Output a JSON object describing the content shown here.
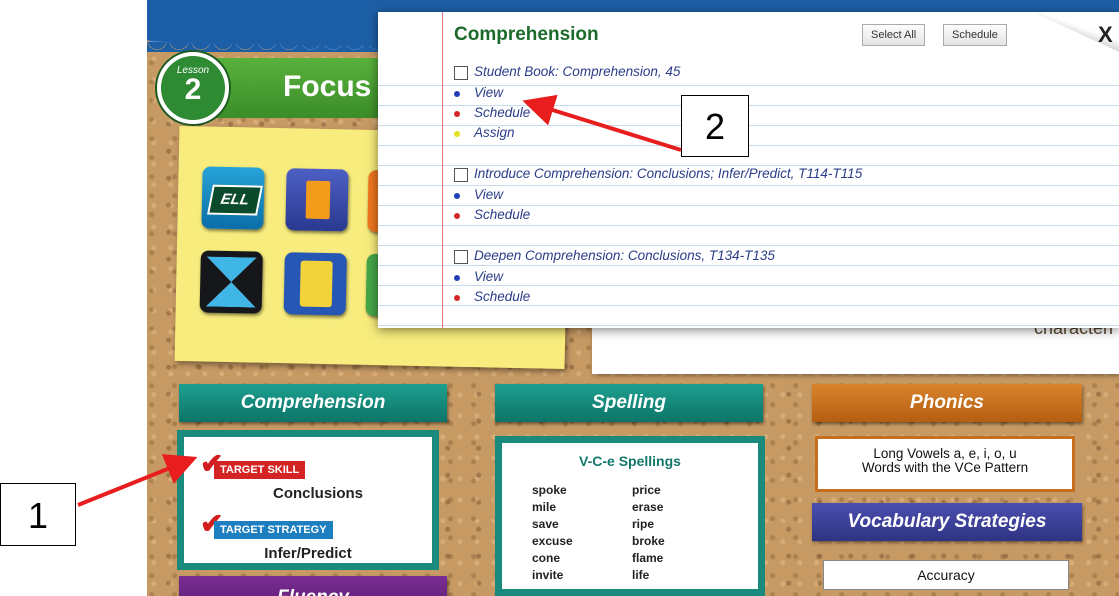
{
  "app": {
    "lesson_word": "Lesson",
    "lesson_number": "2",
    "focus_title": "Focus",
    "card_cut_text": "characteri"
  },
  "tools": [
    {
      "name": "ell-icon",
      "label": "ELL"
    },
    {
      "name": "book-icon",
      "label": ""
    },
    {
      "name": "orange-tool-icon",
      "label": ""
    },
    {
      "name": "star-burst-icon",
      "label": ""
    },
    {
      "name": "abcd-card-icon",
      "label": ""
    },
    {
      "name": "green-tool-icon",
      "label": ""
    }
  ],
  "categories": {
    "comprehension": {
      "label": "Comprehension",
      "target_skill_tag": "TARGET SKILL",
      "target_skill": "Conclusions",
      "target_strategy_tag": "TARGET STRATEGY",
      "target_strategy": "Infer/Predict"
    },
    "spelling": {
      "label": "Spelling",
      "heading": "V-C-e Spellings",
      "words": [
        "spoke",
        "price",
        "mile",
        "erase",
        "save",
        "ripe",
        "excuse",
        "broke",
        "cone",
        "flame",
        "invite",
        "life"
      ]
    },
    "phonics": {
      "label": "Phonics",
      "text_line1": "Long Vowels a, e, i, o, u",
      "text_line2": "Words with the VCe Pattern"
    },
    "vocabulary": {
      "label": "Vocabulary Strategies",
      "value": "Accuracy"
    },
    "fluency": {
      "label": "Fluency"
    }
  },
  "popup": {
    "title": "Comprehension",
    "select_all_label": "Select All",
    "schedule_label": "Schedule",
    "close_label": "X",
    "resources": [
      {
        "title": "Student Book: Comprehension, 45",
        "actions": [
          "View",
          "Schedule",
          "Assign"
        ]
      },
      {
        "title": "Introduce Comprehension: Conclusions; Infer/Predict, T114-T115",
        "actions": [
          "View",
          "Schedule"
        ]
      },
      {
        "title": "Deepen Comprehension: Conclusions, T134-T135",
        "actions": [
          "View",
          "Schedule"
        ]
      }
    ]
  },
  "callouts": {
    "one": "1",
    "two": "2"
  },
  "colors": {
    "arrow": "#e81e1e",
    "popup_title": "#1c6b2c",
    "link": "#2a3d8a"
  }
}
